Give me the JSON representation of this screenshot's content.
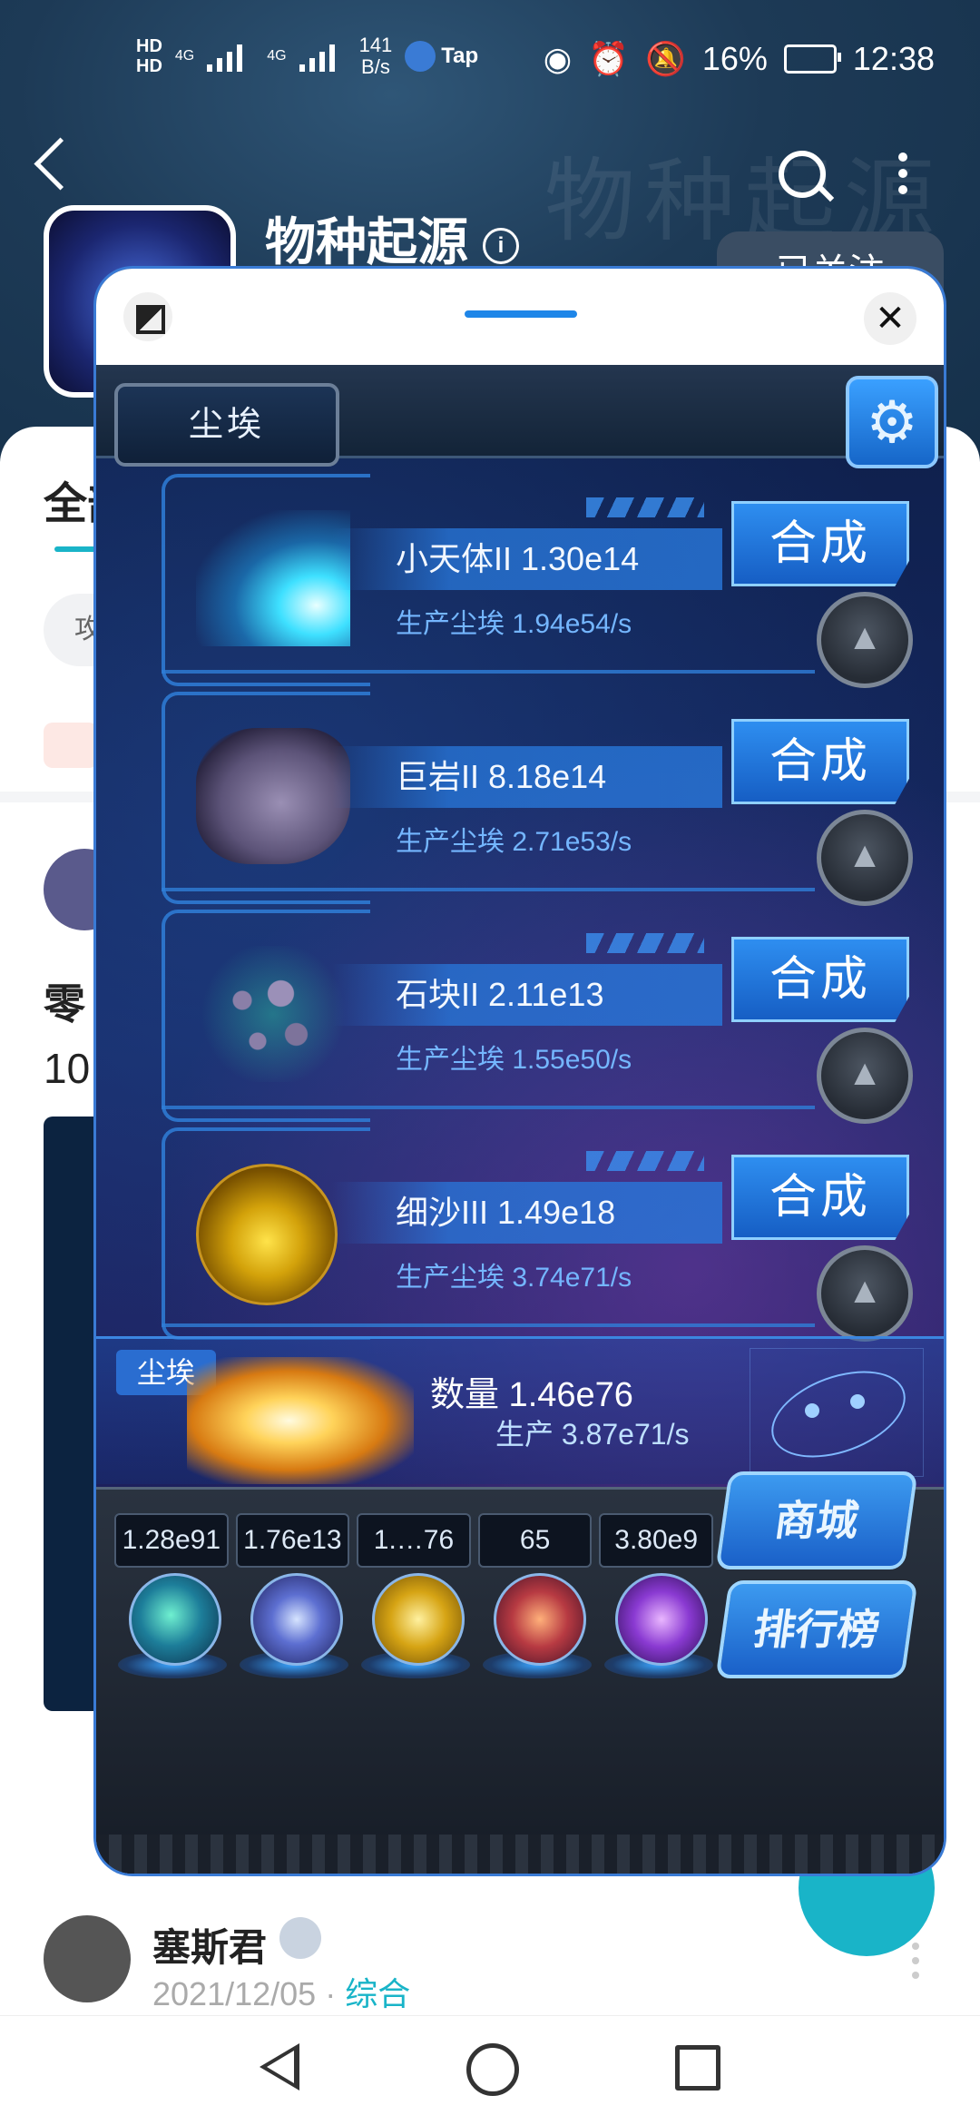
{
  "status_bar": {
    "hd1": "HD",
    "hd2": "HD",
    "net1": "4G",
    "net2": "4G",
    "speed": "141",
    "speed_unit": "B/s",
    "tap_label": "Tap",
    "battery_percent": "16%",
    "time": "12:38"
  },
  "app_header": {
    "title": "物种起源",
    "watermark": "物种起源",
    "follow_button": "已关注"
  },
  "background": {
    "tab_partial": "全部",
    "chip_partial": "攻",
    "post_title_partial": "零",
    "post_number_partial": "10",
    "author_name": "塞斯君",
    "author_date": "2021/12/05",
    "author_separator": "·",
    "author_category": "综合"
  },
  "game": {
    "header_label": "尘埃",
    "rows": [
      {
        "name": "小天体II 1.30e14",
        "production": "生产尘埃  1.94e54/s",
        "merge_label": "合成"
      },
      {
        "name": "巨岩II 8.18e14",
        "production": "生产尘埃  2.71e53/s",
        "merge_label": "合成"
      },
      {
        "name": "石块II 2.11e13",
        "production": "生产尘埃  1.55e50/s",
        "merge_label": "合成"
      },
      {
        "name": "细沙III 1.49e18",
        "production": "生产尘埃  3.74e71/s",
        "merge_label": "合成"
      }
    ],
    "dust_panel": {
      "label": "尘埃",
      "count": "数量 1.46e76",
      "production": "生产 3.87e71/s"
    },
    "counters": [
      "1.28e91",
      "1.76e13",
      "1.…76",
      "65",
      "3.80e9"
    ],
    "shop_button": "商城",
    "rank_button": "排行榜"
  }
}
